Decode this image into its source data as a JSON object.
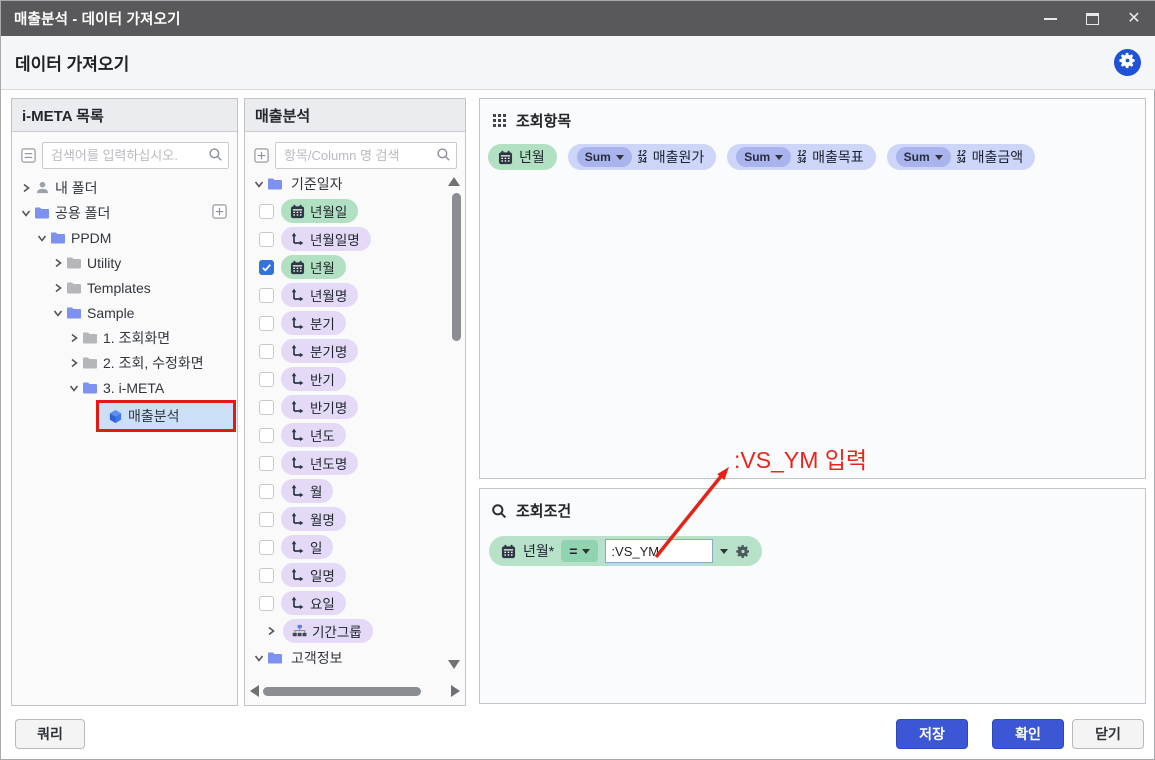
{
  "window": {
    "title": "매출분석 - 데이터 가져오기"
  },
  "header": {
    "title": "데이터 가져오기"
  },
  "colors": {
    "titlebar": "#59595b",
    "accent_blue": "#3c57d5",
    "annotation_red": "#e8251c",
    "chip_date_green": "#b2e0c2",
    "chip_dim_purple": "#e4daf8",
    "chip_measure_blue": "#cdd5f9",
    "selection_blue": "#cbdff7",
    "filter_pill_green": "#b7e1c9"
  },
  "left_panel": {
    "title": "i-META 목록",
    "search_placeholder": "검색어를 입력하십시오.",
    "tree": [
      {
        "label": "내 폴더",
        "depth": 0,
        "chevron": "right",
        "icon": "user-icon"
      },
      {
        "label": "공용 폴더",
        "depth": 0,
        "chevron": "down",
        "icon": "folder-open-icon",
        "add_button": true
      },
      {
        "label": "PPDM",
        "depth": 1,
        "chevron": "down",
        "icon": "folder-open-icon"
      },
      {
        "label": "Utility",
        "depth": 2,
        "chevron": "right",
        "icon": "folder-icon"
      },
      {
        "label": "Templates",
        "depth": 2,
        "chevron": "right",
        "icon": "folder-icon"
      },
      {
        "label": "Sample",
        "depth": 2,
        "chevron": "down",
        "icon": "folder-open-icon"
      },
      {
        "label": "1. 조회화면",
        "depth": 3,
        "chevron": "right",
        "icon": "folder-icon"
      },
      {
        "label": "2. 조회, 수정화면",
        "depth": 3,
        "chevron": "right",
        "icon": "folder-icon"
      },
      {
        "label": "3. i-META",
        "depth": 3,
        "chevron": "down",
        "icon": "folder-open-icon"
      },
      {
        "label": "매출분석",
        "depth": 4,
        "chevron": null,
        "icon": "cube-icon",
        "selected": true,
        "red_box": true
      }
    ]
  },
  "middle_panel": {
    "title": "매출분석",
    "search_placeholder": "항목/Column 명 검색",
    "items": [
      {
        "kind": "folder",
        "label": "기준일자",
        "chevron": "down"
      },
      {
        "kind": "field",
        "chip": "date",
        "label": "년월일",
        "checked": false
      },
      {
        "kind": "field",
        "chip": "dim",
        "label": "년월일명",
        "checked": false
      },
      {
        "kind": "field",
        "chip": "date",
        "label": "년월",
        "checked": true
      },
      {
        "kind": "field",
        "chip": "dim",
        "label": "년월명",
        "checked": false
      },
      {
        "kind": "field",
        "chip": "dim",
        "label": "분기",
        "checked": false
      },
      {
        "kind": "field",
        "chip": "dim",
        "label": "분기명",
        "checked": false
      },
      {
        "kind": "field",
        "chip": "dim",
        "label": "반기",
        "checked": false
      },
      {
        "kind": "field",
        "chip": "dim",
        "label": "반기명",
        "checked": false
      },
      {
        "kind": "field",
        "chip": "dim",
        "label": "년도",
        "checked": false
      },
      {
        "kind": "field",
        "chip": "dim",
        "label": "년도명",
        "checked": false
      },
      {
        "kind": "field",
        "chip": "dim",
        "label": "월",
        "checked": false
      },
      {
        "kind": "field",
        "chip": "dim",
        "label": "월명",
        "checked": false
      },
      {
        "kind": "field",
        "chip": "dim",
        "label": "일",
        "checked": false
      },
      {
        "kind": "field",
        "chip": "dim",
        "label": "일명",
        "checked": false
      },
      {
        "kind": "field",
        "chip": "dim",
        "label": "요일",
        "checked": false
      },
      {
        "kind": "group",
        "chip": "group",
        "label": "기간그룹",
        "chevron": "right"
      },
      {
        "kind": "folder",
        "label": "고객정보",
        "chevron": "down"
      }
    ]
  },
  "query_items_panel": {
    "title": "조회항목",
    "chips": [
      {
        "kind": "date",
        "label": "년월"
      },
      {
        "kind": "measure",
        "agg": "Sum",
        "label": "매출원가"
      },
      {
        "kind": "measure",
        "agg": "Sum",
        "label": "매출목표"
      },
      {
        "kind": "measure",
        "agg": "Sum",
        "label": "매출금액"
      }
    ]
  },
  "query_filter_panel": {
    "title": "조회조건",
    "condition": {
      "field": "년월*",
      "operator": "=",
      "value": ":VS_YM"
    }
  },
  "annotation": {
    "text": ":VS_YM 입력"
  },
  "footer": {
    "query_label": "쿼리",
    "save_label": "저장",
    "ok_label": "확인",
    "close_label": "닫기"
  }
}
